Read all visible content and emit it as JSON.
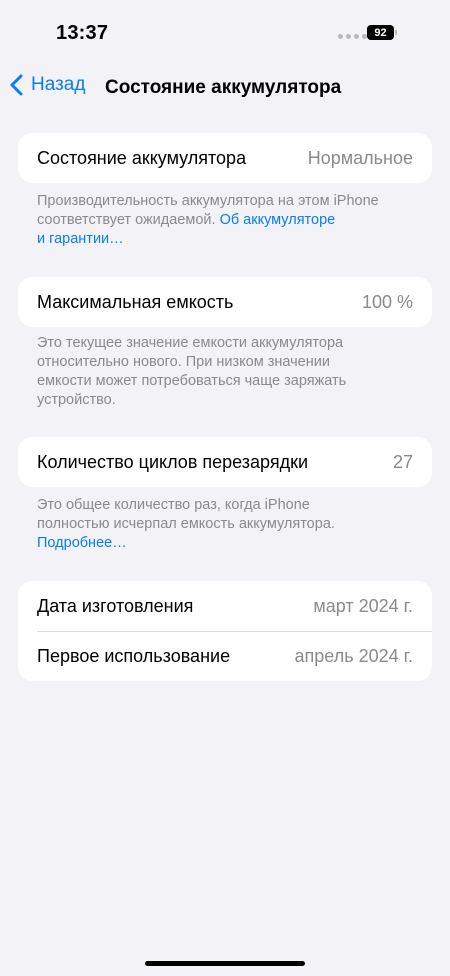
{
  "status_bar": {
    "time": "13:37",
    "battery": "92"
  },
  "nav": {
    "back_label": "Назад",
    "title": "Состояние аккумулятора"
  },
  "battery_health": {
    "label": "Состояние аккумулятора",
    "value": "Нормальное",
    "footnote_line1": "Производительность аккумулятора на этом iPhone",
    "footnote_line2": "соответствует ожидаемой.",
    "link_part1": "Об аккумуляторе",
    "link_part2": "и гарантии…"
  },
  "max_capacity": {
    "label": "Максимальная емкость",
    "value": "100 %",
    "footnote_lines": [
      "Это текущее значение емкости аккумулятора",
      "относительно нового. При низком значении",
      "емкости может потребоваться чаще заряжать",
      "устройство."
    ]
  },
  "cycle_count": {
    "label": "Количество циклов перезарядки",
    "value": "27",
    "footnote_lines": [
      "Это общее количество раз, когда iPhone",
      "полностью исчерпал емкость аккумулятора."
    ],
    "link": "Подробнее…"
  },
  "dates": {
    "manufacture_label": "Дата изготовления",
    "manufacture_value": "март 2024 г.",
    "first_use_label": "Первое использование",
    "first_use_value": "апрель 2024 г."
  },
  "colors": {
    "background": "#f2f2f7",
    "accent": "#0a7cf5",
    "secondary_text": "#8a8a8e"
  }
}
